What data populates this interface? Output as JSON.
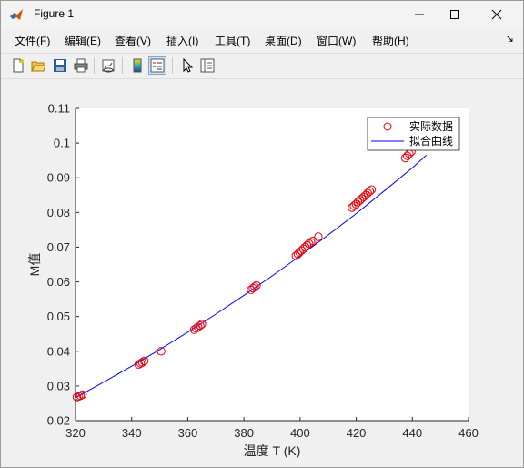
{
  "window": {
    "title": "Figure 1",
    "minimize_label": "—",
    "maximize_label": "☐",
    "close_label": "✕"
  },
  "menu": {
    "items": [
      "文件(F)",
      "编辑(E)",
      "查看(V)",
      "插入(I)",
      "工具(T)",
      "桌面(D)",
      "窗口(W)",
      "帮助(H)"
    ],
    "overflow": "↘"
  },
  "toolbar": {
    "icons": [
      "new-figure-icon",
      "open-file-icon",
      "save-icon",
      "print-icon",
      "link-plot-icon",
      "insert-colorbar-icon",
      "insert-legend-icon",
      "edit-plot-icon",
      "property-inspector-icon"
    ]
  },
  "chart_data": {
    "type": "scatter",
    "xlabel": "温度 T (K)",
    "ylabel": "M值",
    "xlim": [
      320,
      460
    ],
    "ylim": [
      0.02,
      0.11
    ],
    "xticks": [
      "320",
      "340",
      "360",
      "380",
      "400",
      "420",
      "440",
      "460"
    ],
    "yticks": [
      "0.02",
      "0.03",
      "0.04",
      "0.05",
      "0.06",
      "0.07",
      "0.08",
      "0.09",
      "0.1",
      "0.11"
    ],
    "grid": false,
    "legend_position": "top-right",
    "series": [
      {
        "name": "实际数据",
        "kind": "markers",
        "marker": "circle",
        "color": "#e8000b",
        "x": [
          320.5,
          321.2,
          321.8,
          322.5,
          342.5,
          343.2,
          343.8,
          344.5,
          350.5,
          362.3,
          363.0,
          363.7,
          364.4,
          365.0,
          382.5,
          383.2,
          383.8,
          384.5,
          398.5,
          399.2,
          399.8,
          400.5,
          401.1,
          401.8,
          402.5,
          403.2,
          403.9,
          404.6,
          406.5,
          418.5,
          419.2,
          419.9,
          420.6,
          421.3,
          422.0,
          422.7,
          423.4,
          424.1,
          424.8,
          425.5,
          437.5,
          438.2,
          438.9,
          439.6
        ],
        "y": [
          0.0268,
          0.027,
          0.0272,
          0.0275,
          0.0362,
          0.0365,
          0.0368,
          0.0372,
          0.04,
          0.0462,
          0.0466,
          0.047,
          0.0474,
          0.0478,
          0.0577,
          0.0582,
          0.0586,
          0.059,
          0.0675,
          0.068,
          0.0685,
          0.069,
          0.0695,
          0.07,
          0.0705,
          0.071,
          0.0714,
          0.0718,
          0.073,
          0.0814,
          0.0819,
          0.0824,
          0.083,
          0.0835,
          0.084,
          0.0845,
          0.085,
          0.0856,
          0.0861,
          0.0866,
          0.0957,
          0.0963,
          0.0969,
          0.0975
        ]
      },
      {
        "name": "拟合曲线",
        "kind": "line",
        "color": "#0000ff",
        "x": [
          320,
          330,
          340,
          350,
          360,
          370,
          380,
          390,
          400,
          410,
          420,
          430,
          440,
          445
        ],
        "y": [
          0.0266,
          0.0311,
          0.0357,
          0.0405,
          0.0455,
          0.0507,
          0.0561,
          0.0617,
          0.0675,
          0.0735,
          0.0797,
          0.0862,
          0.0929,
          0.0965
        ]
      }
    ]
  }
}
